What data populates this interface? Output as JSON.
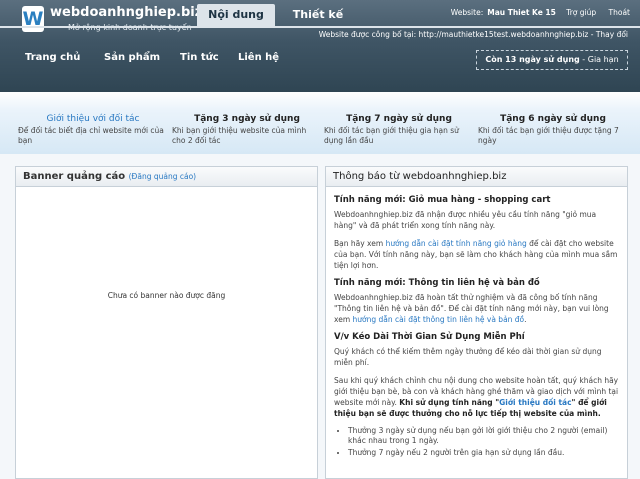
{
  "header": {
    "logo_letter": "W",
    "logo_name": "webdoanhnghiep.biz",
    "tagline": "Mở rộng kinh doanh trực tuyến",
    "tabs": [
      {
        "label": "Nội dung"
      },
      {
        "label": "Thiết kế"
      }
    ],
    "top_links": {
      "website_label": "Website:",
      "website_name": "Mau Thiet Ke 15",
      "help": "Trợ giúp",
      "logout": "Thoát"
    },
    "published_text": "Website được công bố tại: http://mauthietke15test.webdoanhnghiep.biz - Thay đổi",
    "nav": [
      {
        "label": "Trang chủ"
      },
      {
        "label": "Sản phẩm"
      },
      {
        "label": "Tin tức"
      },
      {
        "label": "Liên hệ"
      }
    ],
    "days_left": {
      "bold": "Còn 13 ngày sử dụng",
      "rest": " - Gia hạn"
    }
  },
  "promos": [
    {
      "title": "Giới thiệu với đối tác",
      "desc": "Để đối tác biết địa chỉ website mới của bạn"
    },
    {
      "title": "Tặng 3 ngày sử dụng",
      "desc": "Khi bạn giới thiệu website của mình cho 2 đối tác"
    },
    {
      "title": "Tặng 7 ngày sử dụng",
      "desc": "Khi đối tác bạn giới thiệu gia hạn sử dụng lần đầu"
    },
    {
      "title": "Tặng 6 ngày sử dụng",
      "desc": "Khi đối tác bạn giới thiệu được tặng 7 ngày"
    }
  ],
  "banner_panel": {
    "title": "Banner quảng cáo",
    "register_link": "(Đăng quảng cáo)",
    "empty_text": "Chưa có banner nào được đăng"
  },
  "notice_panel": {
    "title": "Thông báo từ webdoanhnghiep.biz",
    "s1_title": "Tính năng mới: Giỏ mua hàng - shopping cart",
    "s1_p1": "Webdoanhnghiep.biz đã nhận được nhiều yêu cầu tính năng \"giỏ mua hàng\" và đã phát triển xong tính năng này.",
    "s1_p2_a": "Bạn hãy xem ",
    "s1_p2_link": "hướng dẫn cài đặt tính năng giỏ hàng",
    "s1_p2_b": " để cài đặt cho website của bạn. Với tính năng này, bạn sẽ làm cho khách hàng của mình mua sắm tiện lợi hơn.",
    "s2_title": "Tính năng mới: Thông tin liên hệ và bản đồ",
    "s2_p1_a": "Webdoanhnghiep.biz đã hoàn tất thử nghiệm và đã công bố tính năng \"Thông tin liên hệ và bản đồ\". Để cài đặt tính năng mới này, bạn vui lòng xem ",
    "s2_p1_link": "hướng dẫn cài đặt thông tin liên hệ và bản đồ",
    "s2_p1_b": ".",
    "s3_title": "V/v Kéo Dài Thời Gian Sử Dụng Miễn Phí",
    "s3_p1": "Quý khách có thể kiếm thêm ngày thưởng để kéo dài thời gian sử dụng miễn phí.",
    "s3_p2_a": "Sau khi quý khách chỉnh chu nội dung cho website hoàn tất, quý khách hãy giới thiệu bạn bè, bà con và khách hàng ghé thăm và giao dịch với mình tại website mới này. ",
    "s3_p2_bold1": "Khi sử dụng tính năng \"",
    "s3_p2_link": "Giới thiệu đối tác",
    "s3_p2_bold2": "\" để giới thiệu bạn sẽ được thưởng cho nỗ lực tiếp thị website của mình.",
    "bullets": [
      "Thưởng 3 ngày sử dụng nếu bạn gởi lời giới thiệu cho 2 người (email) khác nhau trong 1 ngày.",
      "Thưởng 7 ngày nếu 2 người trên gia hạn sử dụng lần đầu."
    ]
  }
}
